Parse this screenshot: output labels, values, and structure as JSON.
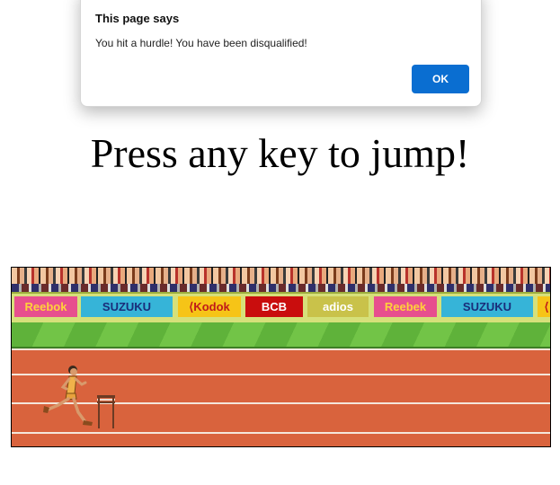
{
  "dialog": {
    "title": "This page says",
    "message": "You hit a hurdle! You have been disqualified!",
    "ok_label": "OK"
  },
  "heading": "Press any key to jump!",
  "game": {
    "banners": [
      {
        "text": "Reebok",
        "bg": "#e74f8e",
        "fg": "#ffd23a"
      },
      {
        "text": "SUZUKU",
        "bg": "#36b4d8",
        "fg": "#1a2d7a"
      },
      {
        "text": "⟨Kodok",
        "bg": "#f6c417",
        "fg": "#c01919"
      },
      {
        "text": "BCB",
        "bg": "#c90d0d",
        "fg": "#ffffff"
      },
      {
        "text": "adios",
        "bg": "#c9c24a",
        "fg": "#ffffff"
      },
      {
        "text": "Reebek",
        "bg": "#e74f8e",
        "fg": "#ffd23a"
      },
      {
        "text": "SUZUKU",
        "bg": "#36b4d8",
        "fg": "#1a2d7a"
      },
      {
        "text": "⟨",
        "bg": "#f6c417",
        "fg": "#c01919"
      }
    ],
    "colors": {
      "track": "#d9633d",
      "grass": "#5fb23a",
      "lane_line": "#f4e6da"
    },
    "icons": {
      "runner": "runner-sprite",
      "hurdle": "hurdle-sprite"
    }
  }
}
